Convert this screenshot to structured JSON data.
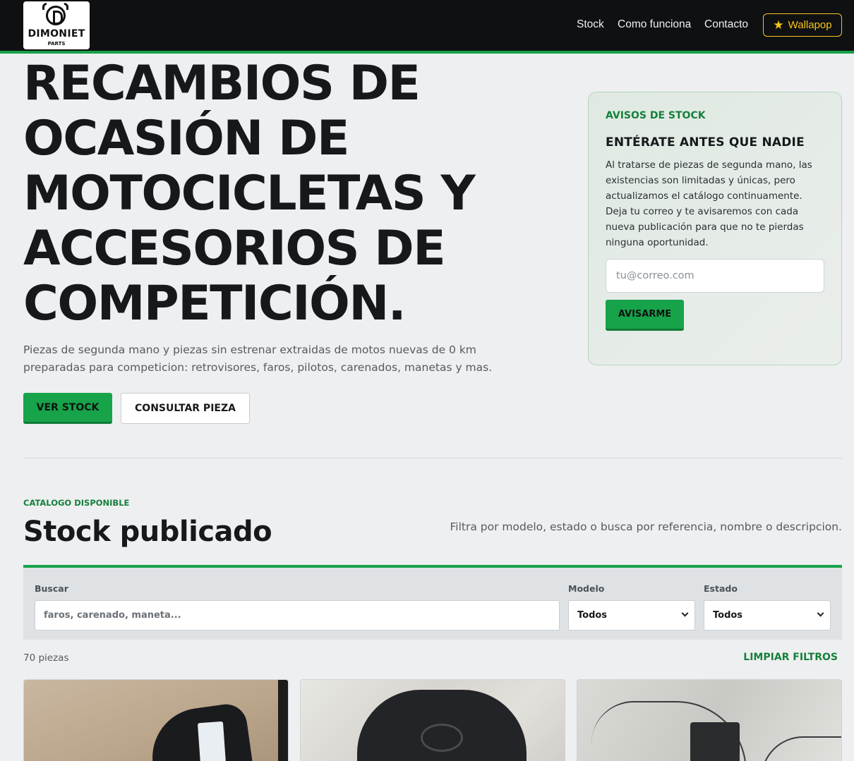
{
  "brand": {
    "name": "DIMONIET",
    "sub": "PARTS"
  },
  "nav": {
    "stock": "Stock",
    "how": "Como funciona",
    "contact": "Contacto",
    "wallapop": "Wallapop"
  },
  "hero": {
    "title": "RECAMBIOS DE OCASIÓN DE MOTOCICLETAS Y ACCESORIOS DE COMPETICIÓN.",
    "text": "Piezas de segunda mano y piezas sin estrenar extraidas de motos nuevas de 0 km preparadas para competicion: retrovisores, faros, pilotos, carenados, manetas y mas.",
    "primary": "VER STOCK",
    "secondary": "CONSULTAR PIEZA"
  },
  "alerts": {
    "kicker": "AVISOS DE STOCK",
    "title": "ENTÉRATE ANTES QUE NADIE",
    "text": "Al tratarse de piezas de segunda mano, las existencias son limitadas y únicas, pero actualizamos el catálogo continuamente. Deja tu correo y te avisaremos con cada nueva publicación para que no te pierdas ninguna oportunidad.",
    "placeholder": "tu@correo.com",
    "button": "AVISARME"
  },
  "catalog": {
    "kicker": "CATALOGO DISPONIBLE",
    "title": "Stock publicado",
    "subtitle": "Filtra por modelo, estado o busca por referencia, nombre o descripcion."
  },
  "filters": {
    "search_label": "Buscar",
    "search_placeholder": "faros, carenado, maneta...",
    "model_label": "Modelo",
    "model_value": "Todos",
    "state_label": "Estado",
    "state_value": "Todos"
  },
  "results": {
    "count": "70 piezas",
    "clear": "LIMPIAR FILTROS"
  },
  "colors": {
    "accent": "#16a34a",
    "dark": "#0f1012",
    "wallapop": "#f5c518"
  }
}
